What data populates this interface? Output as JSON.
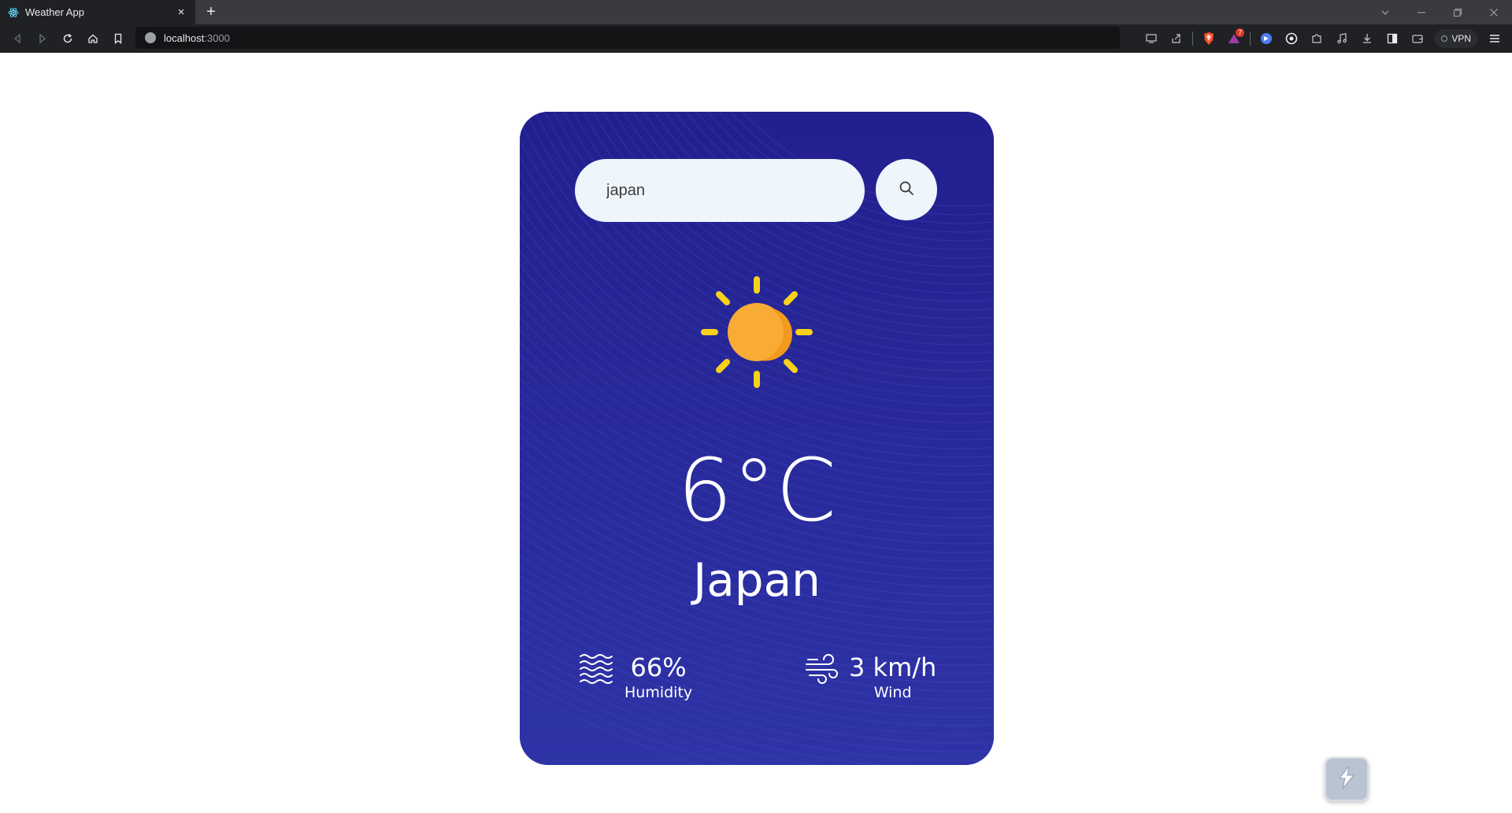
{
  "browser": {
    "tab_title": "Weather App",
    "url_host": "localhost",
    "url_port": ":3000",
    "vpn_label": "VPN",
    "extension_badge": "7"
  },
  "app": {
    "search": {
      "value": "japan",
      "placeholder": "Search"
    },
    "weather_icon": "sun-icon",
    "temperature": "6°C",
    "city": "Japan",
    "humidity": {
      "value": "66%",
      "label": "Humidity"
    },
    "wind": {
      "value": "3 km/h",
      "label": "Wind"
    }
  },
  "colors": {
    "card_background": "#272a96",
    "sun_body": "#f9ac35",
    "sun_rays": "#f7d11a",
    "input_background": "#eef5fb"
  }
}
